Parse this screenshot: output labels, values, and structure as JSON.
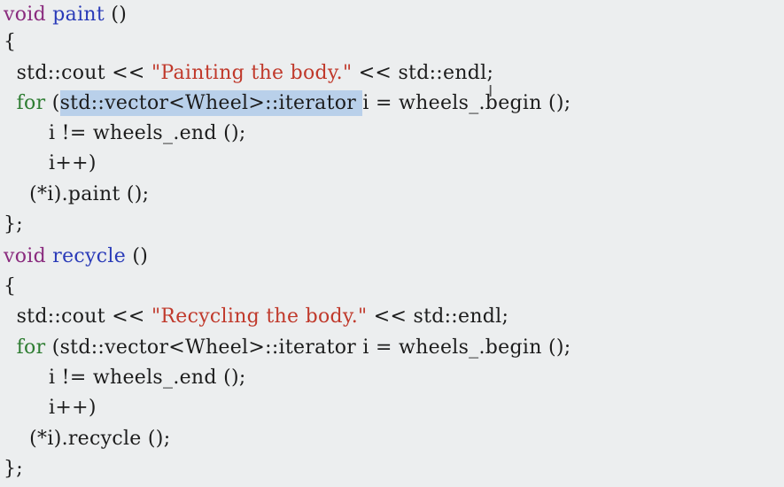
{
  "code": {
    "l1": {
      "keyword": "void",
      "fname": "paint",
      "rest": " ()"
    },
    "l2": {
      "text": "{"
    },
    "l3": {
      "pre": "  std::cout << ",
      "string": "\"Painting the body.\"",
      "post": " << std::endl;"
    },
    "l4": {
      "indent": "  ",
      "keyword": "for",
      "open": " (",
      "selected": "std::vector<Wheel>::iterator ",
      "post": "i = wheels_.begin ();"
    },
    "l5": {
      "text": "       i != wheels_.end ();"
    },
    "l6": {
      "text": "       i++)"
    },
    "l7": {
      "text": "    (*i).paint ();"
    },
    "l8": {
      "text": "};"
    },
    "l9": {
      "keyword": "void",
      "fname": "recycle",
      "rest": " ()"
    },
    "l10": {
      "text": "{"
    },
    "l11": {
      "pre": "  std::cout << ",
      "string": "\"Recycling the body.\"",
      "post": " << std::endl;"
    },
    "l12": {
      "indent": "  ",
      "keyword": "for",
      "post": " (std::vector<Wheel>::iterator i = wheels_.begin ();"
    },
    "l13": {
      "text": "       i != wheels_.end ();"
    },
    "l14": {
      "text": "       i++)"
    },
    "l15": {
      "text": "    (*i).recycle ();"
    },
    "l16": {
      "text": "};"
    }
  },
  "cursor": {
    "glyph": "I"
  },
  "colors": {
    "background": "#eceeef",
    "keyword_void": "#8a2b7e",
    "function_name": "#2a3bb8",
    "keyword_for": "#2e7d32",
    "string": "#c0392b",
    "selection": "#b9d0ea"
  }
}
